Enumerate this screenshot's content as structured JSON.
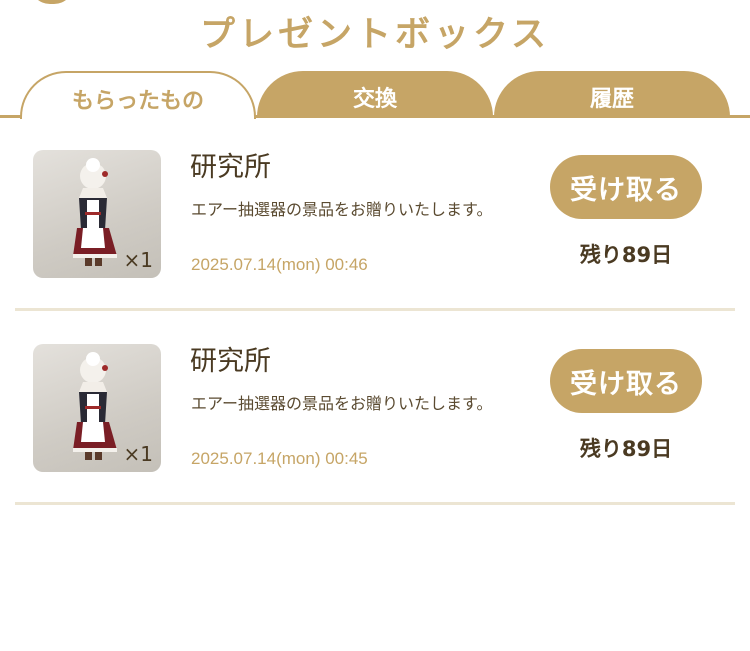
{
  "header": {
    "title": "プレゼントボックス"
  },
  "tabs": [
    {
      "label": "もらったもの",
      "active": true
    },
    {
      "label": "交換",
      "active": false
    },
    {
      "label": "履歴",
      "active": false
    }
  ],
  "colors": {
    "accent": "#c6a566",
    "text": "#4a3a22",
    "separator": "#ece5d3"
  },
  "items": [
    {
      "sender": "研究所",
      "message": "エアー抽選器の景品をお贈りいたします。",
      "date": "2025.07.14(mon) 00:46",
      "quantity": "×1",
      "button": "受け取る",
      "remaining": "残り89日",
      "thumbnail_icon": "maid-outfit-icon"
    },
    {
      "sender": "研究所",
      "message": "エアー抽選器の景品をお贈りいたします。",
      "date": "2025.07.14(mon) 00:45",
      "quantity": "×1",
      "button": "受け取る",
      "remaining": "残り89日",
      "thumbnail_icon": "maid-outfit-icon"
    }
  ]
}
